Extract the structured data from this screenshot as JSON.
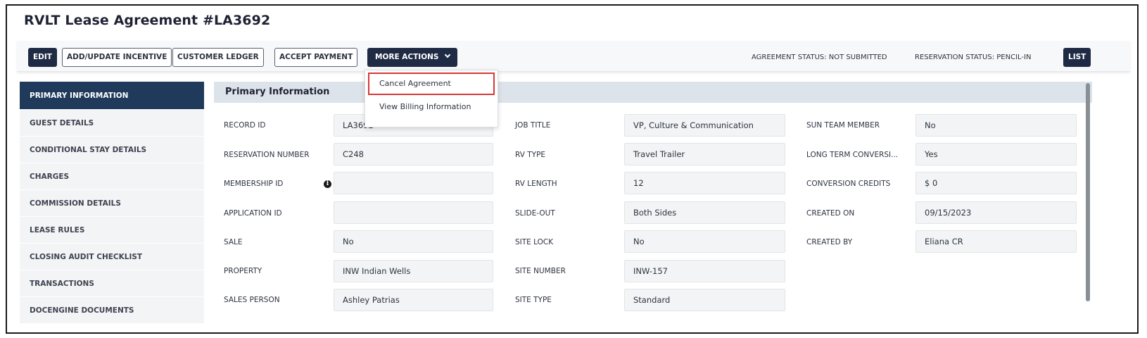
{
  "window": {
    "title": "RVLT Lease Agreement #LA3692"
  },
  "toolbar": {
    "edit": "EDIT",
    "add_update_incentive": "ADD/UPDATE INCENTIVE",
    "customer_ledger": "CUSTOMER LEDGER",
    "accept_payment": "ACCEPT PAYMENT",
    "more_actions": "MORE ACTIONS",
    "agreement_status": "AGREEMENT STATUS: NOT SUBMITTED",
    "reservation_status": "RESERVATION STATUS: PENCIL-IN",
    "list": "LIST"
  },
  "more_actions_menu": [
    {
      "label": "Cancel Agreement"
    },
    {
      "label": "View Billing Information"
    }
  ],
  "sidebar": {
    "items": [
      {
        "label": "PRIMARY INFORMATION"
      },
      {
        "label": "GUEST DETAILS"
      },
      {
        "label": "CONDITIONAL STAY DETAILS"
      },
      {
        "label": "CHARGES"
      },
      {
        "label": "COMMISSION DETAILS"
      },
      {
        "label": "LEASE RULES"
      },
      {
        "label": "CLOSING AUDIT CHECKLIST"
      },
      {
        "label": "TRANSACTIONS"
      },
      {
        "label": "DOCENGINE DOCUMENTS"
      }
    ]
  },
  "panel": {
    "title": "Primary Information",
    "col1": [
      {
        "label": "RECORD ID",
        "value": "LA3692"
      },
      {
        "label": "RESERVATION NUMBER",
        "value": "C248"
      },
      {
        "label": "MEMBERSHIP ID",
        "value": ""
      },
      {
        "label": "APPLICATION ID",
        "value": ""
      },
      {
        "label": "SALE",
        "value": "No"
      },
      {
        "label": "PROPERTY",
        "value": "INW Indian Wells"
      },
      {
        "label": "SALES PERSON",
        "value": "Ashley Patrias"
      }
    ],
    "col2": [
      {
        "label": "JOB TITLE",
        "value": "VP, Culture & Communication"
      },
      {
        "label": "RV TYPE",
        "value": "Travel Trailer"
      },
      {
        "label": "RV LENGTH",
        "value": "12"
      },
      {
        "label": "SLIDE-OUT",
        "value": "Both Sides"
      },
      {
        "label": "SITE LOCK",
        "value": "No"
      },
      {
        "label": "SITE NUMBER",
        "value": "INW-157"
      },
      {
        "label": "SITE TYPE",
        "value": "Standard"
      }
    ],
    "col3": [
      {
        "label": "SUN TEAM MEMBER",
        "value": "No"
      },
      {
        "label": "LONG TERM CONVERSI...",
        "value": "Yes"
      },
      {
        "label": "CONVERSION CREDITS",
        "value": "$ 0"
      },
      {
        "label": "CREATED ON",
        "value": "09/15/2023"
      },
      {
        "label": "CREATED BY",
        "value": "Eliana CR"
      }
    ]
  },
  "colors": {
    "dark_navy": "#1f2a44",
    "sidebar_active": "#1f3a5a",
    "highlight_border": "#d93636"
  }
}
